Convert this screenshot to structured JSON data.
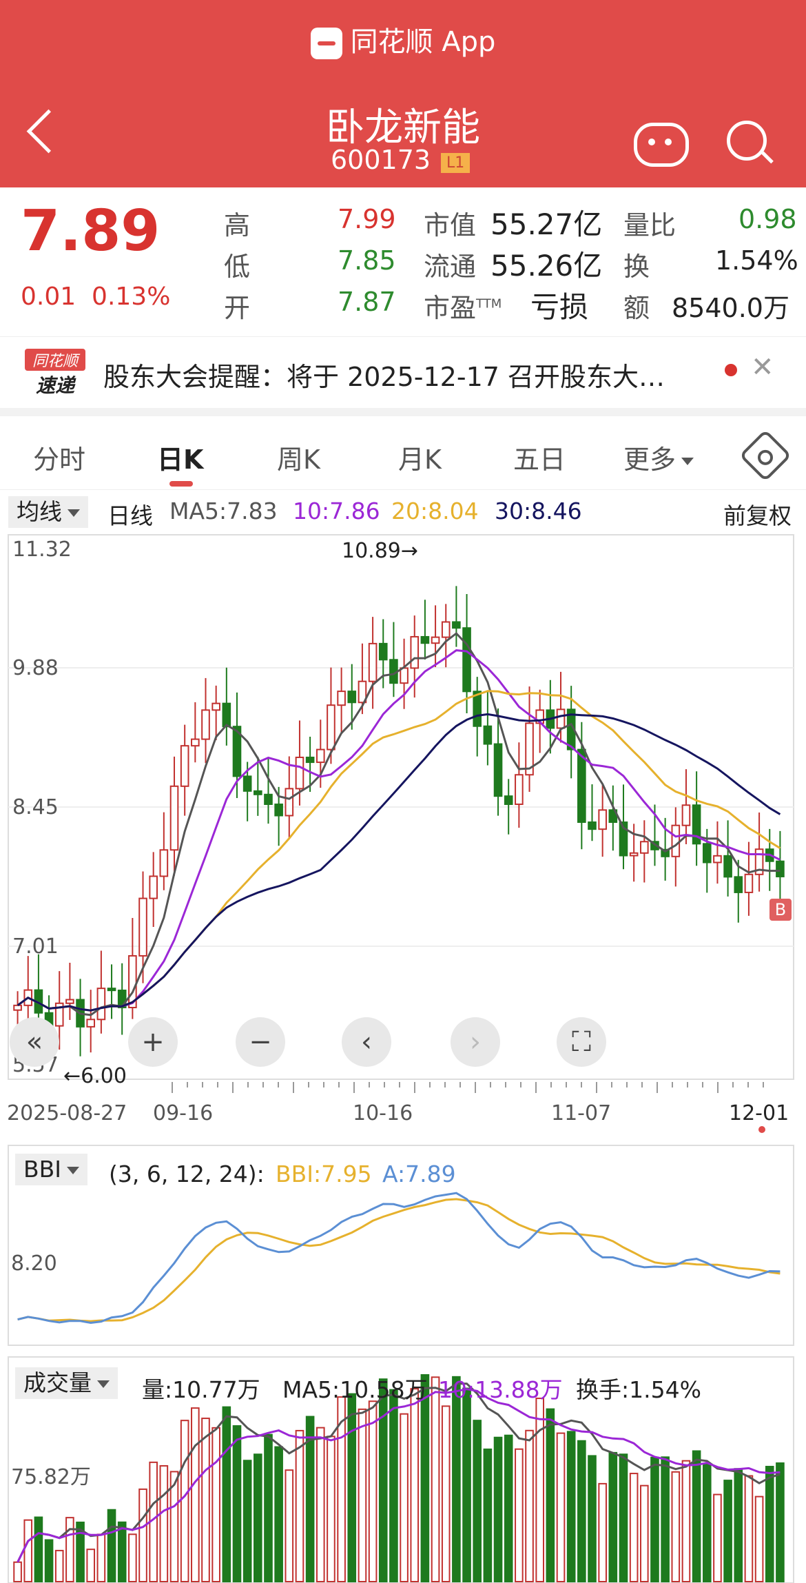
{
  "header": {
    "app_name": "同花顺 App",
    "stock_name": "卧龙新能",
    "stock_code": "600173",
    "level_badge": "L1"
  },
  "quote": {
    "price": "7.89",
    "change": "0.01",
    "change_pct": "0.13%",
    "rows": [
      {
        "l1": "高",
        "v1": "7.99",
        "l2": "市值",
        "v2": "55.27亿",
        "l3": "量比",
        "v3": "0.98"
      },
      {
        "l1": "低",
        "v1": "7.85",
        "l2": "流通",
        "v2": "55.26亿",
        "l3": "换",
        "v3": "1.54%"
      },
      {
        "l1": "开",
        "v1": "7.87",
        "l2": "市盈",
        "v2": "亏损",
        "l3": "额",
        "v3": "8540.0万"
      }
    ],
    "pe_sup": "TTM"
  },
  "notice": {
    "logo_top": "同花顺",
    "logo_bottom": "速递",
    "text": "股东大会提醒：将于 2025-12-17 召开股东大…"
  },
  "tabs": [
    "分时",
    "日K",
    "周K",
    "月K",
    "五日",
    "更多"
  ],
  "ma": {
    "dropdown": "均线",
    "period": "日线",
    "ma5": "MA5:7.83",
    "ma10": "10:7.86",
    "ma20": "20:8.04",
    "ma30": "30:8.46",
    "adjust": "前复权"
  },
  "kline": {
    "y_labels": [
      "11.32",
      "9.88",
      "8.45",
      "7.01",
      "5.57"
    ],
    "high_mark": "10.89→",
    "low_mark": "←6.00",
    "x_labels": [
      "2025-08-27",
      "09-16",
      "10-16",
      "11-07",
      "12-01"
    ],
    "b_marker": "B"
  },
  "bbi": {
    "dropdown": "BBI",
    "params": "(3, 6, 12, 24):",
    "bbi": "BBI:7.95",
    "a": "A:7.89",
    "y_label": "8.20"
  },
  "volume": {
    "dropdown": "成交量",
    "vol": "量:10.77万",
    "ma5": "MA5:10.58万",
    "ma10": "10:13.88万",
    "turnover": "换手:1.54%",
    "y_label": "75.82万"
  },
  "colors": {
    "up": "#c1312f",
    "down": "#1e7a1e",
    "ma5": "#555555",
    "ma10": "#9b27d6",
    "ma20": "#e6b12d",
    "ma30": "#15155f",
    "bbi": "#e6b12d",
    "a": "#5b8fd4",
    "header": "#e04b49"
  }
}
